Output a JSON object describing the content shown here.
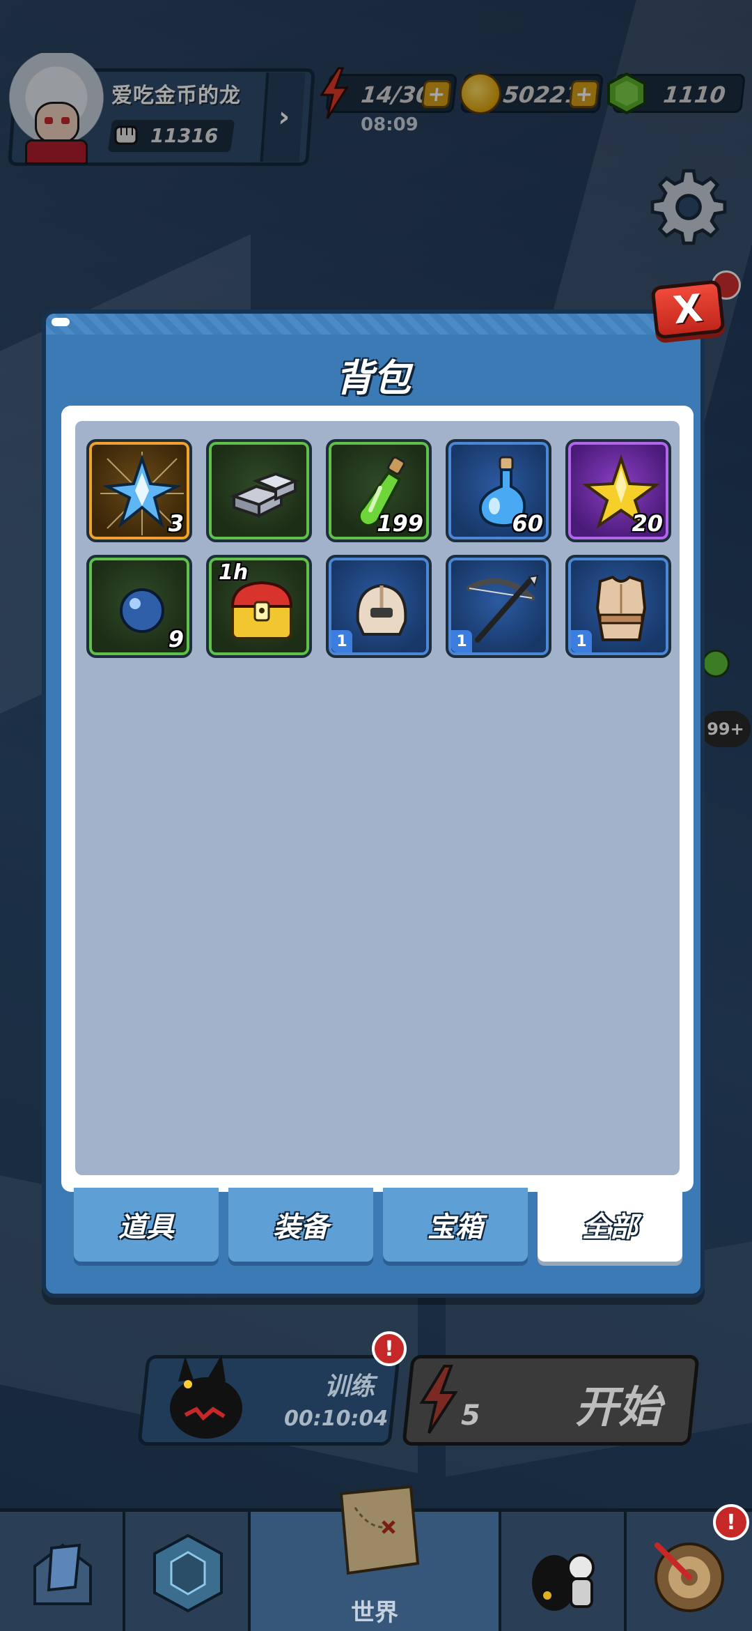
{
  "player": {
    "name": "爱吃金币的龙",
    "power": "11316"
  },
  "resources": {
    "energy": "14/30",
    "energy_timer": "08:09",
    "coins": "50221",
    "gems": "1110",
    "plus_label": "+"
  },
  "dialog": {
    "title": "背包",
    "close_label": "X"
  },
  "inventory": {
    "items": [
      {
        "name": "crystal-shard",
        "rarity": "gold",
        "count": "3"
      },
      {
        "name": "iron-ingots",
        "rarity": "green",
        "count": ""
      },
      {
        "name": "green-potion",
        "rarity": "green",
        "count": "199"
      },
      {
        "name": "blue-potion",
        "rarity": "blue",
        "count": "60"
      },
      {
        "name": "gold-star",
        "rarity": "purple",
        "count": "20"
      },
      {
        "name": "blue-orb",
        "rarity": "green",
        "count": "9"
      },
      {
        "name": "treasure-chest",
        "rarity": "green",
        "count": "",
        "timer": "1h"
      },
      {
        "name": "helmet",
        "rarity": "blue",
        "level": "1"
      },
      {
        "name": "crossbow",
        "rarity": "blue",
        "level": "1"
      },
      {
        "name": "leather-armor",
        "rarity": "blue",
        "level": "1"
      }
    ]
  },
  "tabs": [
    {
      "label": "道具",
      "active": false
    },
    {
      "label": "装备",
      "active": false
    },
    {
      "label": "宝箱",
      "active": false
    },
    {
      "label": "全部",
      "active": true
    }
  ],
  "training": {
    "label": "训练",
    "timer": "00:10:04",
    "alert": "!"
  },
  "start": {
    "cost": "5",
    "label": "开始"
  },
  "side": {
    "badge": "99+"
  },
  "navbar": {
    "world_label": "世界",
    "alert": "!"
  },
  "colors": {
    "dialog_bg": "#3b7ab5",
    "panel_bg": "#a3b2cb",
    "close_red": "#e0372a",
    "rarity_green": "#5fc14a",
    "rarity_blue": "#4b87d6",
    "rarity_purple": "#b266ea",
    "rarity_gold": "#f0a22a"
  }
}
